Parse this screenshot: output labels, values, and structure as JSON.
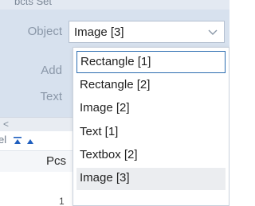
{
  "panel": {
    "title": "bcts Set",
    "object_label": "Object",
    "add_label": "Add",
    "text_label": "Text",
    "object_combo_value": "Image [3]"
  },
  "scrollbar": {
    "left_arrow": "<"
  },
  "toolbar": {
    "partial_text": "el"
  },
  "grid": {
    "header_pcs": "Pcs",
    "row_number": "1"
  },
  "dropdown": {
    "options": [
      "Rectangle [1]",
      "Rectangle [2]",
      "Image [2]",
      "Text [1]",
      "Textbox [2]",
      "Image [3]"
    ],
    "focused_index": 0,
    "selected_index": 5
  },
  "colors": {
    "panel_bg": "#d7e1ee",
    "focus_border": "#2b6cb0",
    "selected_bg": "#ebedf0",
    "label_text": "#8a97a8"
  },
  "icons": {
    "combo_arrow": "chevron-down-icon",
    "toolbar_first": "move-to-top-icon",
    "toolbar_up": "move-up-icon"
  }
}
